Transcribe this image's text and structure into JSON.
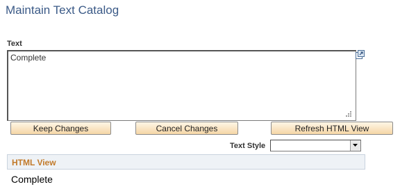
{
  "page": {
    "title": "Maintain Text Catalog"
  },
  "text_field": {
    "label": "Text",
    "value": "Complete"
  },
  "buttons": {
    "keep_changes": "Keep Changes",
    "cancel_changes": "Cancel Changes",
    "refresh_html_view": "Refresh HTML View"
  },
  "text_style": {
    "label": "Text Style",
    "selected": ""
  },
  "html_view": {
    "title": "HTML View",
    "content": "Complete"
  },
  "colors": {
    "title": "#3b5a87",
    "section_title": "#c27a2a",
    "section_bg": "#eef2f6",
    "button_bg": "#f5d6a6"
  },
  "icons": {
    "expand": "expand-popup-icon",
    "resize": "resize-grip-icon",
    "dropdown": "chevron-down-icon"
  }
}
